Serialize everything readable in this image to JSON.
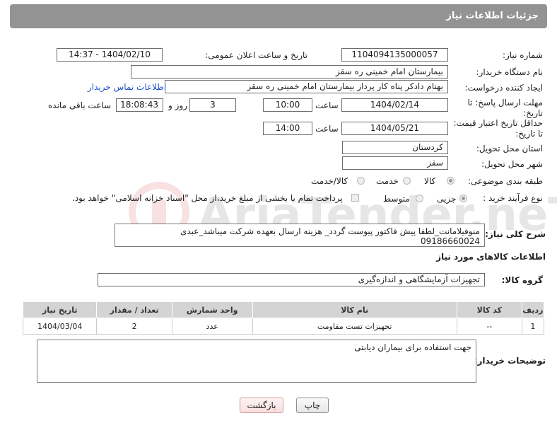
{
  "header": {
    "title": "جزئیات اطلاعات نیاز"
  },
  "fields": {
    "need_number_label": "شماره نیاز:",
    "need_number": "1104094135000057",
    "announce_label": "تاریخ و ساعت اعلان عمومی:",
    "announce_value": "1404/02/10 - 14:37",
    "buyer_org_label": "نام دستگاه خریدار:",
    "buyer_org": "بیمارستان امام خمینی  ره  سقز",
    "creator_label": "ایجاد کننده درخواست:",
    "creator": "بهنام دادکر پناه کار پرداز بیمارستان امام خمینی  ره  سقز",
    "contact_link": "اطلاعات تماس خریدار",
    "reply_deadline_label_1": "مهلت ارسال پاسخ: تا",
    "reply_deadline_label_2": "تاریخ:",
    "reply_date": "1404/02/14",
    "time_label": "ساعت",
    "reply_time": "10:00",
    "days_value": "3",
    "days_label": "روز و",
    "remaining_time": "18:08:43",
    "remaining_label": "ساعت باقی مانده",
    "price_validity_label_1": "حداقل تاریخ اعتبار قیمت:",
    "price_validity_label_2": "تا تاریخ:",
    "validity_date": "1404/05/21",
    "validity_time": "14:00",
    "province_label": "استان محل تحویل:",
    "province": "کردستان",
    "city_label": "شهر محل تحویل:",
    "city": "سقز",
    "category_label": "طبقه بندی موضوعی:",
    "category_options": [
      "کالا",
      "خدمت",
      "کالا/خدمت"
    ],
    "category_selected": "کالا",
    "purchase_type_label": "نوع فرآیند خرید :",
    "purchase_options": [
      "جزیی",
      "متوسط"
    ],
    "purchase_selected": "جزیی",
    "payment_note": "پرداخت تمام یا بخشی از مبلغ خرید،از محل \"اسناد خزانه اسلامی\" خواهد بود."
  },
  "description": {
    "label": "شرح کلی نیاز:",
    "text": "منوفیلامانت_لطفا پیش فاکتور پیوست گردد_ هزینه ارسال بعهده شرکت میباشد_عبدی 09186660024"
  },
  "goods_section": {
    "title": "اطلاعات کالاهای مورد نیاز",
    "group_label": "گروه کالا:",
    "group_value": "تجهیزات آزمایشگاهی و اندازه‌گیری"
  },
  "table": {
    "headers": [
      "ردیف",
      "کد کالا",
      "نام کالا",
      "واحد شمارش",
      "تعداد / مقدار",
      "تاریخ نیاز"
    ],
    "rows": [
      [
        "1",
        "--",
        "تجهیزات تست مقاومت",
        "عدد",
        "2",
        "1404/03/04"
      ]
    ]
  },
  "buyer_notes": {
    "label": "توضیحات خریدار:",
    "text": "جهت استفاده برای بیماران دیابتی"
  },
  "buttons": {
    "print": "چاپ",
    "back": "بازگشت"
  },
  "colors": {
    "header_bg": "#939393",
    "link": "#1d53c9",
    "table_header": "#d4d4d4"
  }
}
